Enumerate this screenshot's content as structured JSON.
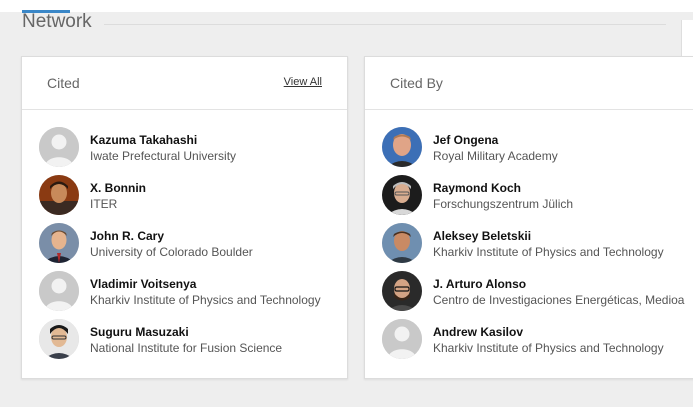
{
  "section": {
    "title": "Network"
  },
  "cited": {
    "title": "Cited",
    "view_all_label": "View All",
    "people": [
      {
        "name": "Kazuma Takahashi",
        "affiliation": "Iwate Prefectural University",
        "photo": "placeholder"
      },
      {
        "name": "X. Bonnin",
        "affiliation": "ITER",
        "photo": "photo"
      },
      {
        "name": "John R. Cary",
        "affiliation": "University of Colorado Boulder",
        "photo": "photo"
      },
      {
        "name": "Vladimir Voitsenya",
        "affiliation": "Kharkiv Institute of Physics and Technology",
        "photo": "placeholder"
      },
      {
        "name": "Suguru Masuzaki",
        "affiliation": "National Institute for Fusion Science",
        "photo": "photo"
      }
    ]
  },
  "cited_by": {
    "title": "Cited By",
    "people": [
      {
        "name": "Jef Ongena",
        "affiliation": "Royal Military Academy",
        "photo": "photo"
      },
      {
        "name": "Raymond Koch",
        "affiliation": "Forschungszentrum Jülich",
        "photo": "photo"
      },
      {
        "name": "Aleksey Beletskii",
        "affiliation": "Kharkiv Institute of Physics and Technology",
        "photo": "photo"
      },
      {
        "name": "J. Arturo Alonso",
        "affiliation": "Centro de Investigaciones Energéticas, Medioa",
        "photo": "photo"
      },
      {
        "name": "Andrew Kasilov",
        "affiliation": "Kharkiv Institute of Physics and Technology",
        "photo": "placeholder"
      }
    ]
  },
  "colors": {
    "accent": "#3a87c8",
    "placeholder_bg": "#c6c6c6"
  }
}
